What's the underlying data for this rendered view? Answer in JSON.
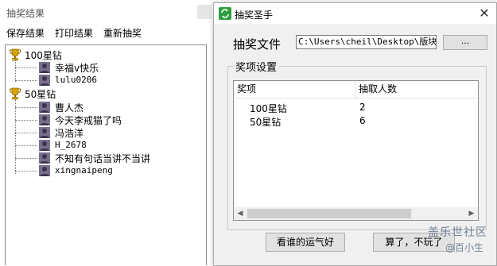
{
  "results_window": {
    "title": "抽奖结果",
    "menu": [
      "保存结果",
      "打印结果",
      "重新抽奖"
    ],
    "groups": [
      {
        "label": "100星钻",
        "winners": [
          "幸福v快乐",
          "lulu0206"
        ]
      },
      {
        "label": "50星钻",
        "winners": [
          "曹人杰",
          "今天李戒猫了吗",
          "冯浩洋",
          "H_2678",
          "不知有句话当讲不当讲",
          "xingnaipeng"
        ]
      }
    ]
  },
  "dialog": {
    "title": "抽奖圣手",
    "close_glyph": "✕",
    "file_label": "抽奖文件",
    "file_path": "C:\\Users\\cheil\\Desktop\\版块活",
    "browse_label": "...",
    "group_label": "奖项设置",
    "table": {
      "columns": [
        "奖项",
        "抽取人数"
      ],
      "rows": [
        [
          "100星钻",
          "2"
        ],
        [
          "50星钻",
          "6"
        ]
      ]
    },
    "scroll_left": "◀",
    "scroll_right": "▶",
    "draw_button": "看谁的运气好",
    "quit_button": "算了，不玩了"
  },
  "watermark": {
    "line1": "盖乐世社区",
    "line2": "@百小生"
  },
  "icons": {
    "trophy": "trophy-icon",
    "avatar": "user-avatar-icon",
    "app": "app-refresh-icon"
  },
  "colors": {
    "dialog_bg": "#f0f0f0",
    "app_icon_green": "#2e9e3e",
    "trophy_gold": "#d9a400",
    "watermark": "#5d6f86"
  }
}
